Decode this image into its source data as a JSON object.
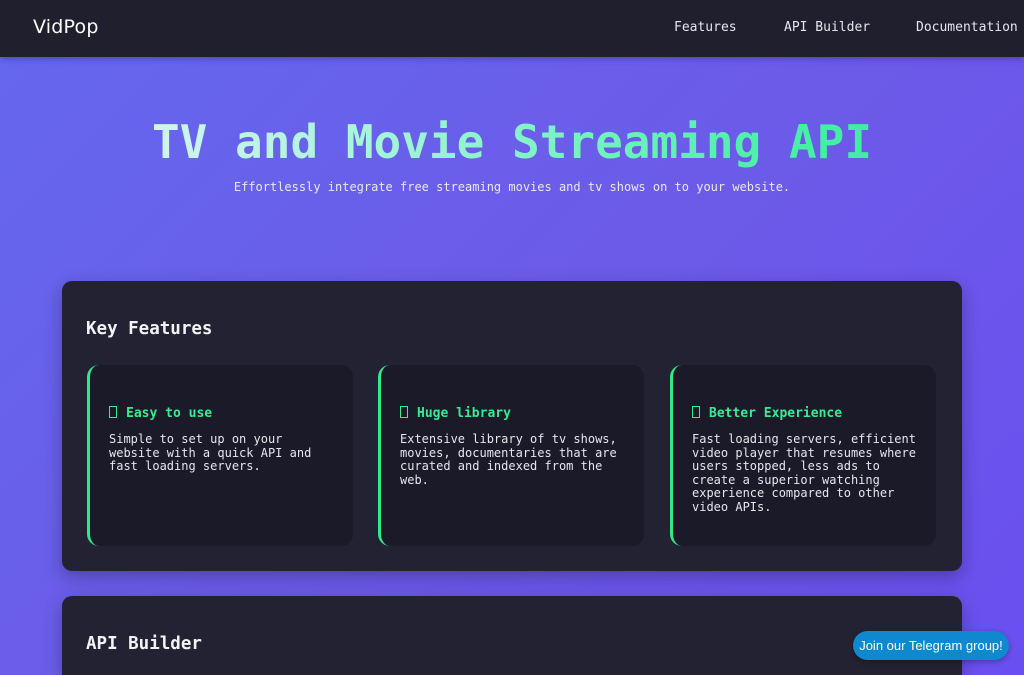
{
  "header": {
    "logo": "VidPop",
    "nav": [
      "Features",
      "API Builder",
      "Documentation"
    ]
  },
  "hero": {
    "title": "TV and Movie Streaming API",
    "subtitle": "Effortlessly integrate free streaming movies and tv shows on to your website."
  },
  "features": {
    "title": "Key Features",
    "cards": [
      {
        "icon": "square-glyph-icon",
        "title": "Easy to use",
        "body": "Simple to set up on your website with a quick API and fast loading servers."
      },
      {
        "icon": "square-glyph-icon",
        "title": "Huge library",
        "body": "Extensive library of tv shows, movies, documentaries that are curated and indexed from the web."
      },
      {
        "icon": "square-glyph-icon",
        "title": "Better Experience",
        "body": "Fast loading servers, efficient video player that resumes where users stopped, less ads to create a superior watching experience compared to other video APIs."
      }
    ]
  },
  "api_builder": {
    "title": "API Builder"
  },
  "telegram": {
    "label": "Join our Telegram group!"
  },
  "colors": {
    "accent": "#36ec92",
    "header_bg": "#1f1f2e",
    "panel_bg": "#222233",
    "telegram": "#0e88cf"
  }
}
